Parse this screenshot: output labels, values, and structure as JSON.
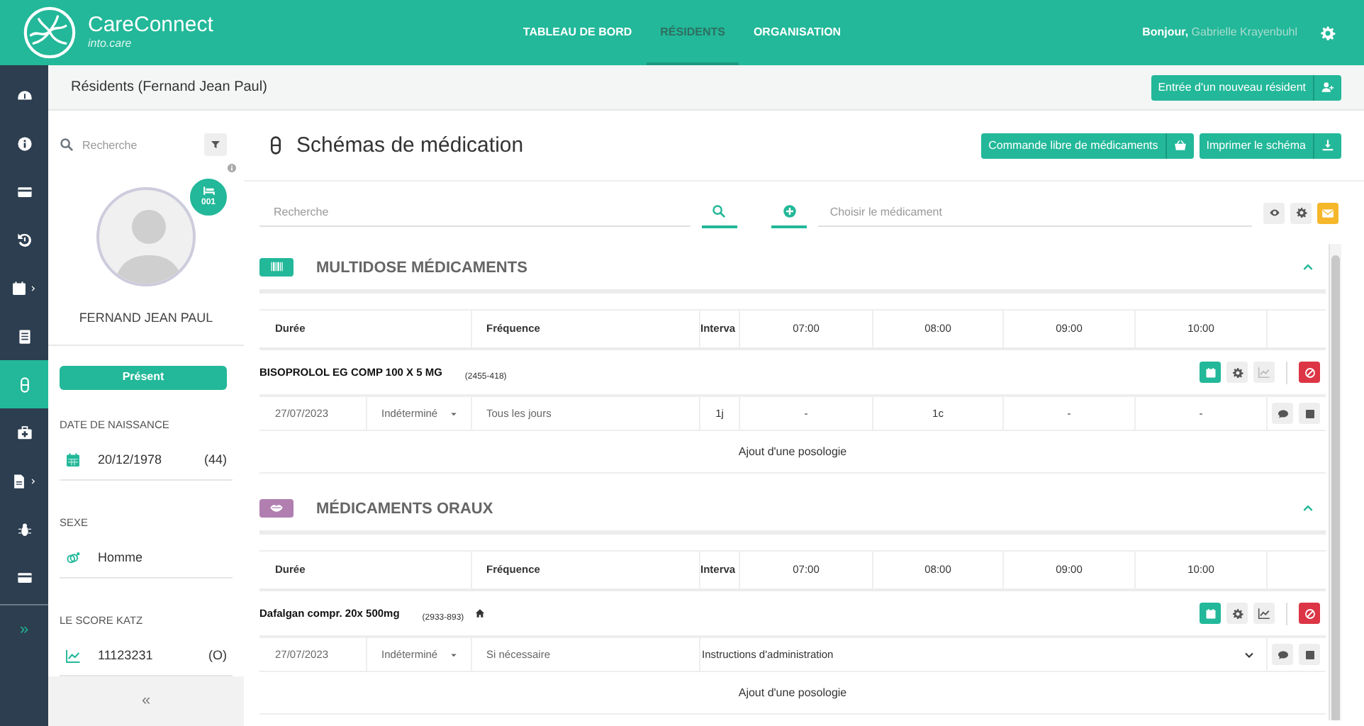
{
  "app": {
    "name": "CareConnect",
    "subtitle": "into.care"
  },
  "nav": [
    {
      "label": "TABLEAU DE BORD",
      "selected": false
    },
    {
      "label": "RÉSIDENTS",
      "selected": true
    },
    {
      "label": "ORGANISATION",
      "selected": false
    }
  ],
  "greeting": {
    "prefix": "Bonjour,",
    "user": "Gabrielle Krayenbuhl"
  },
  "rail": [
    {
      "selected": false,
      "submenu": false
    },
    {
      "selected": false,
      "submenu": false
    },
    {
      "selected": false,
      "submenu": false
    },
    {
      "selected": false,
      "submenu": false
    },
    {
      "selected": false,
      "submenu": true
    },
    {
      "selected": false,
      "submenu": false
    },
    {
      "selected": true,
      "submenu": false
    },
    {
      "selected": false,
      "submenu": false
    },
    {
      "selected": false,
      "submenu": true
    },
    {
      "selected": false,
      "submenu": false
    },
    {
      "selected": false,
      "submenu": false
    }
  ],
  "rail_expand": "»",
  "breadcrumb": "Résidents (Fernand Jean Paul)",
  "new_resident_button": "Entrée d'un nouveau résident",
  "resident": {
    "search_placeholder": "Recherche",
    "room": "001",
    "name": "FERNAND JEAN PAUL",
    "status": "Présent",
    "fields": [
      {
        "label": "DATE DE NAISSANCE",
        "value": "20/12/1978",
        "extra": "(44)"
      },
      {
        "label": "SEXE",
        "value": "Homme"
      },
      {
        "label": "LE SCORE KATZ",
        "value": "11123231",
        "extra": "(O)"
      }
    ],
    "collapse": "«"
  },
  "page": {
    "title": "Schémas de médication",
    "buttons": [
      "Commande libre de médicaments",
      "Imprimer le schéma"
    ]
  },
  "search_placeholder": "Recherche",
  "medication_placeholder": "Choisir le médicament",
  "sections": [
    {
      "title": "MULTIDOSE MÉDICAMENTS",
      "color": "#22b899",
      "expanded": true,
      "columns": [
        "Durée",
        "Fréquence",
        "Interva",
        "07:00",
        "08:00",
        "09:00",
        "10:00"
      ],
      "drugs": [
        {
          "name": "BISOPROLOL EG COMP 100 X 5 MG",
          "code": "(2455-418)",
          "home": false,
          "chart_disabled": true,
          "rows": [
            {
              "kind": "schedule",
              "start": "27/07/2023",
              "duration": "Indéterminé",
              "frequency": "Tous les jours",
              "interval": "1j",
              "doses": [
                "-",
                "1c",
                "-",
                "-"
              ]
            }
          ]
        }
      ],
      "add_label": "Ajout d'une posologie"
    },
    {
      "title": "MÉDICAMENTS ORAUX",
      "color": "#b07fb0",
      "expanded": true,
      "columns": [
        "Durée",
        "Fréquence",
        "Interva",
        "07:00",
        "08:00",
        "09:00",
        "10:00"
      ],
      "drugs": [
        {
          "name": "Dafalgan compr. 20x 500mg",
          "code": "(2933-893)",
          "home": true,
          "chart_disabled": false,
          "rows": [
            {
              "kind": "instructions",
              "start": "27/07/2023",
              "duration": "Indéterminé",
              "frequency": "Si nécessaire",
              "instructions": "Instructions d'administration"
            }
          ]
        }
      ],
      "add_label": "Ajout d'une posologie"
    }
  ]
}
